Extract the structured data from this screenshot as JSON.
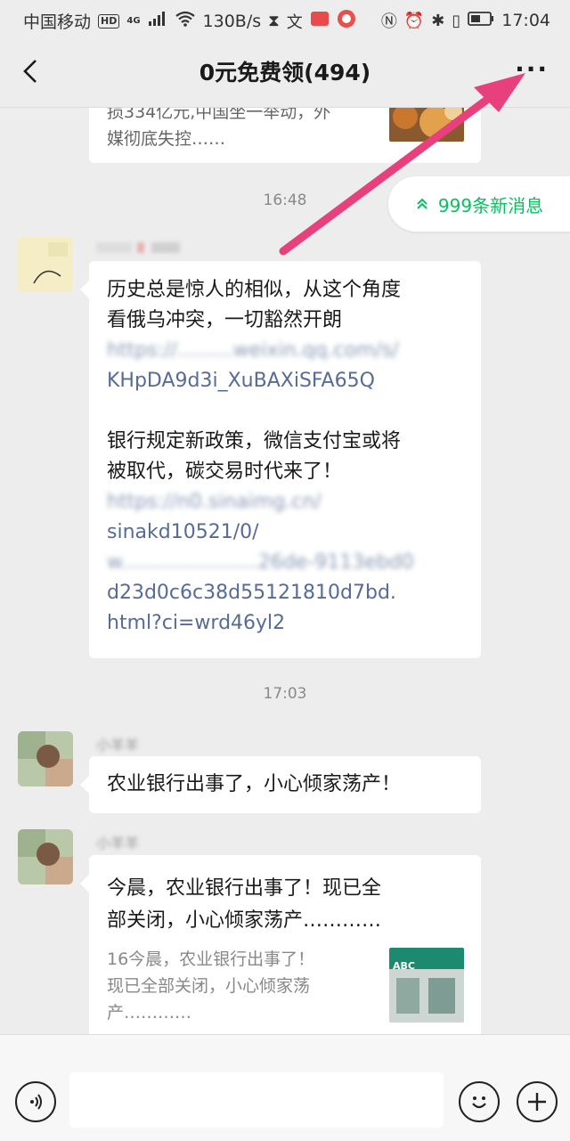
{
  "status_bar": {
    "carrier": "中国移动",
    "hd_badge": "HD",
    "signal": "4G",
    "speed": "130B/s",
    "time": "17:04"
  },
  "header": {
    "title": "0元免费领(494)",
    "more_label": "···"
  },
  "new_messages": {
    "label": "999条新消息"
  },
  "messages": [
    {
      "type": "card",
      "desc": "损334亿元,中国坐一举动，外媒彻底失控……",
      "desc_line1": "损334亿元,中国坐一举动，外",
      "desc_line2": "媒彻底失控……"
    },
    {
      "type": "time",
      "text": "16:48"
    },
    {
      "type": "text",
      "lines": [
        "历史总是惊人的相似，从这个角度",
        "看俄乌冲突，一切豁然开朗",
        "https://.........weixin.qq.com/s/",
        "KHpDA9d3i_XuBAXiSFA65Q",
        "",
        "银行规定新政策，微信支付宝或将",
        "被取代，碳交易时代来了！",
        "https://n0.sinaimg.cn/",
        "sinakd10521/0/",
        "w......................26de-9113ebd0",
        "d23d0c6c38d55121810d7bd.",
        "html?ci=wrd46yl2"
      ]
    },
    {
      "type": "time",
      "text": "17:03"
    },
    {
      "type": "text",
      "sender": "小羊羊",
      "text": "农业银行出事了，小心倾家荡产！"
    },
    {
      "type": "card",
      "sender": "小羊羊",
      "title_line1": "今晨，农业银行出事了！现已全",
      "title_line2": "部关闭，小心倾家荡产…………",
      "desc_line1": "16今晨，农业银行出事了！",
      "desc_line2": "现已全部关闭，小心倾家荡",
      "desc_line3": "产…………",
      "thumb_label": "ABC"
    }
  ],
  "colors": {
    "background": "#ededed",
    "bubble": "#ffffff",
    "link": "#576b95",
    "accent_green": "#07c160",
    "annotation_arrow": "#e8407c"
  }
}
